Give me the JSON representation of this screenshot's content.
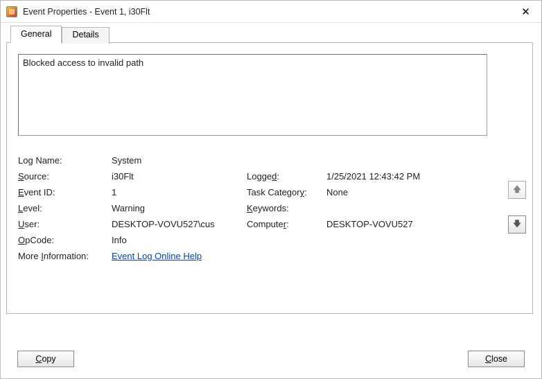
{
  "titlebar": {
    "title": "Event Properties - Event 1, i30Flt",
    "close_icon": "✕"
  },
  "tabs": {
    "general": "General",
    "details": "Details"
  },
  "description": "Blocked access to invalid path",
  "fields": {
    "log_name_label_pre": "Lo",
    "log_name_label_u": "g",
    "log_name_label_post": " Name:",
    "log_name_value": "System",
    "source_label_u": "S",
    "source_label_post": "ource:",
    "source_value": "i30Flt",
    "logged_label_pre": "Logge",
    "logged_label_u": "d",
    "logged_label_post": ":",
    "logged_value": "1/25/2021 12:43:42 PM",
    "event_id_label_u": "E",
    "event_id_label_post": "vent ID:",
    "event_id_value": "1",
    "task_cat_label_pre": "Task Categor",
    "task_cat_label_u": "y",
    "task_cat_label_post": ":",
    "task_cat_value": "None",
    "level_label_u": "L",
    "level_label_post": "evel:",
    "level_value": "Warning",
    "keywords_label_u": "K",
    "keywords_label_post": "eywords:",
    "keywords_value": "",
    "user_label_u": "U",
    "user_label_post": "ser:",
    "user_value": "DESKTOP-VOVU527\\cus",
    "computer_label_pre": "Compute",
    "computer_label_u": "r",
    "computer_label_post": ":",
    "computer_value": "DESKTOP-VOVU527",
    "opcode_label_u": "O",
    "opcode_label_post": "pCode:",
    "opcode_value": "Info",
    "more_info_label_pre": "More ",
    "more_info_label_u": "I",
    "more_info_label_post": "nformation:",
    "more_info_link": "Event Log Online Help"
  },
  "nav": {
    "up": "🡅",
    "down": "🡇"
  },
  "footer": {
    "copy_u": "C",
    "copy_post": "opy",
    "close_u": "C",
    "close_post": "lose"
  }
}
